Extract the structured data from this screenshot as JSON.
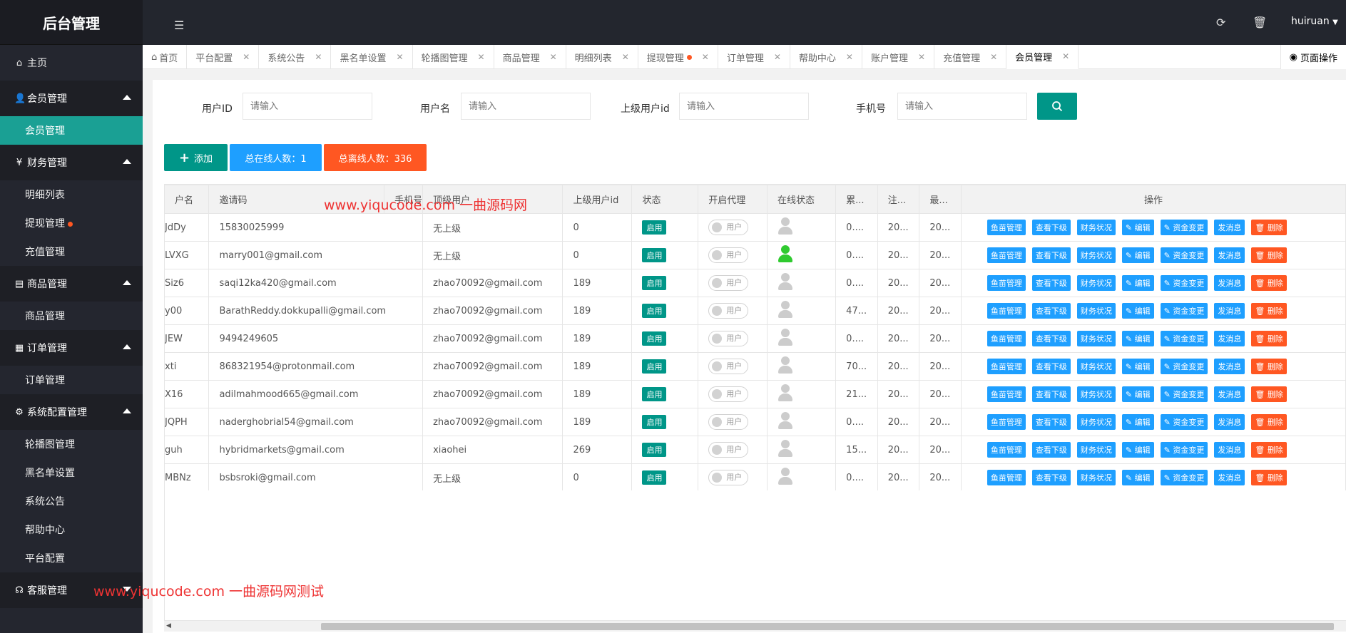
{
  "app": {
    "title": "后台管理",
    "user": "huiruan"
  },
  "sidebar": {
    "home": "主页",
    "groups": [
      {
        "label": "会员管理",
        "icon": "user-icon",
        "expanded": true,
        "items": [
          {
            "label": "会员管理",
            "active": true,
            "dot": false
          }
        ]
      },
      {
        "label": "财务管理",
        "icon": "yen-icon",
        "expanded": true,
        "items": [
          {
            "label": "明细列表",
            "dot": false
          },
          {
            "label": "提现管理",
            "dot": true
          },
          {
            "label": "充值管理",
            "dot": false
          }
        ]
      },
      {
        "label": "商品管理",
        "icon": "list-icon",
        "expanded": true,
        "items": [
          {
            "label": "商品管理",
            "dot": false
          }
        ]
      },
      {
        "label": "订单管理",
        "icon": "order-icon",
        "expanded": true,
        "items": [
          {
            "label": "订单管理",
            "dot": false
          }
        ]
      },
      {
        "label": "系统配置管理",
        "icon": "gear-icon",
        "expanded": true,
        "items": [
          {
            "label": "轮播图管理",
            "dot": false
          },
          {
            "label": "黑名单设置",
            "dot": false
          },
          {
            "label": "系统公告",
            "dot": false
          },
          {
            "label": "帮助中心",
            "dot": false
          },
          {
            "label": "平台配置",
            "dot": false
          }
        ]
      },
      {
        "label": "客服管理",
        "icon": "headset-icon",
        "expanded": false,
        "items": []
      }
    ]
  },
  "tabs": [
    {
      "label": "首页",
      "closable": false,
      "home": true
    },
    {
      "label": "平台配置",
      "closable": true
    },
    {
      "label": "系统公告",
      "closable": true
    },
    {
      "label": "黑名单设置",
      "closable": true
    },
    {
      "label": "轮播图管理",
      "closable": true
    },
    {
      "label": "商品管理",
      "closable": true
    },
    {
      "label": "明细列表",
      "closable": true
    },
    {
      "label": "提现管理",
      "closable": true,
      "dot": true
    },
    {
      "label": "订单管理",
      "closable": true
    },
    {
      "label": "帮助中心",
      "closable": true
    },
    {
      "label": "账户管理",
      "closable": true
    },
    {
      "label": "充值管理",
      "closable": true
    },
    {
      "label": "会员管理",
      "closable": true,
      "active": true
    }
  ],
  "page_ops": "页面操作",
  "search": {
    "fields": [
      {
        "label": "用户ID",
        "placeholder": "请输入"
      },
      {
        "label": "用户名",
        "placeholder": "请输入"
      },
      {
        "label": "上级用户id",
        "placeholder": "请输入"
      },
      {
        "label": "手机号",
        "placeholder": "请输入"
      }
    ]
  },
  "toolbar": {
    "add": "添加",
    "online": "总在线人数：1",
    "offline": "总离线人数：336"
  },
  "table": {
    "columns": [
      "户名",
      "邀请码",
      "手机号",
      "顶级用户",
      "上级用户id",
      "状态",
      "开启代理",
      "在线状态",
      "累...",
      "注...",
      "最...",
      "操作"
    ],
    "status_label": "启用",
    "switch_label": "用户",
    "op_buttons": [
      "鱼苗管理",
      "查看下级",
      "财务状况",
      "编辑",
      "资金变更",
      "发消息",
      "删除"
    ],
    "rows": [
      {
        "name": "JdDy",
        "invite": "15830025999",
        "top": "无上级",
        "parent": "0",
        "online": false,
        "c1": "0....",
        "c2": "20...",
        "c3": "20..."
      },
      {
        "name": "LVXG",
        "invite": "marry001@gmail.com",
        "top": "无上级",
        "parent": "0",
        "online": true,
        "c1": "0....",
        "c2": "20...",
        "c3": "20..."
      },
      {
        "name": "Siz6",
        "invite": "saqi12ka420@gmail.com",
        "top": "zhao70092@gmail.com",
        "parent": "189",
        "online": false,
        "c1": "0....",
        "c2": "20...",
        "c3": "20..."
      },
      {
        "name": "y00",
        "invite": "BarathReddy.dokkupalli@gmail.com",
        "top": "zhao70092@gmail.com",
        "parent": "189",
        "online": false,
        "c1": "47...",
        "c2": "20...",
        "c3": "20..."
      },
      {
        "name": "JEW",
        "invite": "9494249605",
        "top": "zhao70092@gmail.com",
        "parent": "189",
        "online": false,
        "c1": "0....",
        "c2": "20...",
        "c3": "20..."
      },
      {
        "name": "xti",
        "invite": "868321954@protonmail.com",
        "top": "zhao70092@gmail.com",
        "parent": "189",
        "online": false,
        "c1": "70...",
        "c2": "20...",
        "c3": "20..."
      },
      {
        "name": "X16",
        "invite": "adilmahmood665@gmail.com",
        "top": "zhao70092@gmail.com",
        "parent": "189",
        "online": false,
        "c1": "21...",
        "c2": "20...",
        "c3": "20..."
      },
      {
        "name": "JQPH",
        "invite": "naderghobrial54@gmail.com",
        "top": "zhao70092@gmail.com",
        "parent": "189",
        "online": false,
        "c1": "0....",
        "c2": "20...",
        "c3": "20..."
      },
      {
        "name": "guh",
        "invite": "hybridmarkets@gmail.com",
        "top": "xiaohei",
        "parent": "269",
        "online": false,
        "c1": "15...",
        "c2": "20...",
        "c3": "20..."
      },
      {
        "name": "MBNz",
        "invite": "bsbsroki@gmail.com",
        "top": "无上级",
        "parent": "0",
        "online": false,
        "c1": "0....",
        "c2": "20...",
        "c3": "20..."
      }
    ]
  },
  "watermarks": {
    "top": "www.yiqucode.com 一曲源码网",
    "bottom": "www.yiqucode.com 一曲源码网测试"
  },
  "colors": {
    "sidebar_bg": "#24262f",
    "accent": "#009688",
    "primary_blue": "#1e9fff",
    "danger": "#ff5722"
  }
}
